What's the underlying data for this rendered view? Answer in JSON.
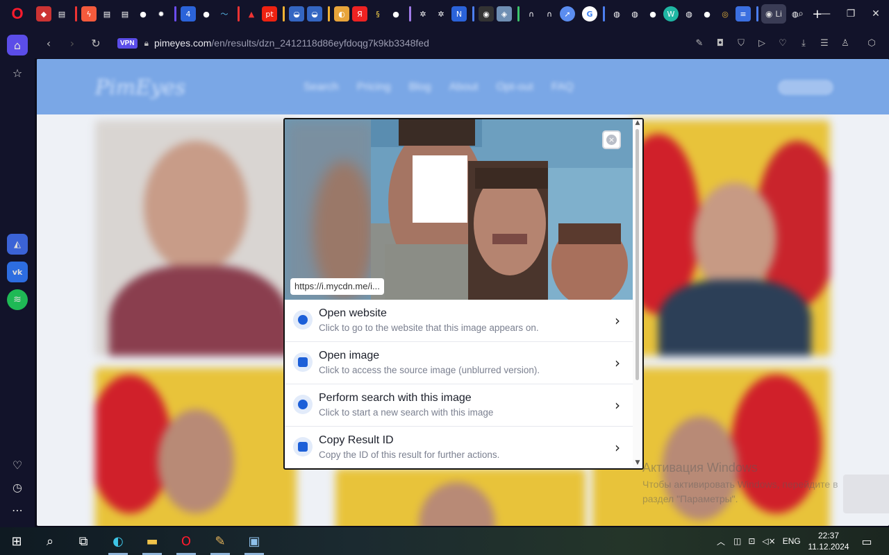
{
  "browser": {
    "address": {
      "vpn_label": "VPN",
      "url_host": "pimeyes.com",
      "url_path": "/en/results/dzn_2412118d86eyfdoqg7k9kb3348fed"
    },
    "active_tab_label": "Li"
  },
  "tab_icons": [
    "4",
    "pt",
    "G",
    "W",
    "N"
  ],
  "page": {
    "logo": "PimEyes",
    "nav": [
      "Search",
      "Pricing",
      "Blog",
      "About",
      "Opt-out",
      "FAQ"
    ]
  },
  "modal": {
    "source_url": "https://i.mycdn.me/i...",
    "close_label": "×",
    "actions": [
      {
        "title": "Open website",
        "subtitle": "Click to go to the website that this image appears on.",
        "icon": "globe-icon"
      },
      {
        "title": "Open image",
        "subtitle": "Click to access the source image (unblurred version).",
        "icon": "image-icon"
      },
      {
        "title": "Perform search with this image",
        "subtitle": "Click to start a new search with this image",
        "icon": "search-icon"
      },
      {
        "title": "Copy Result ID",
        "subtitle": "Copy the ID of this result for further actions.",
        "icon": "copy-icon"
      }
    ]
  },
  "windows_activation": {
    "title": "Активация Windows",
    "line1": "Чтобы активировать Windows, перейдите в",
    "line2": "раздел \"Параметры\"."
  },
  "taskbar": {
    "language": "ENG",
    "time": "22:37",
    "date": "11.12.2024"
  },
  "colors": {
    "accent": "#1c5fd8",
    "browser_bg": "#12132a",
    "vpn_badge": "#5b4de8",
    "pimeyes_header": "#7aa7e6"
  }
}
